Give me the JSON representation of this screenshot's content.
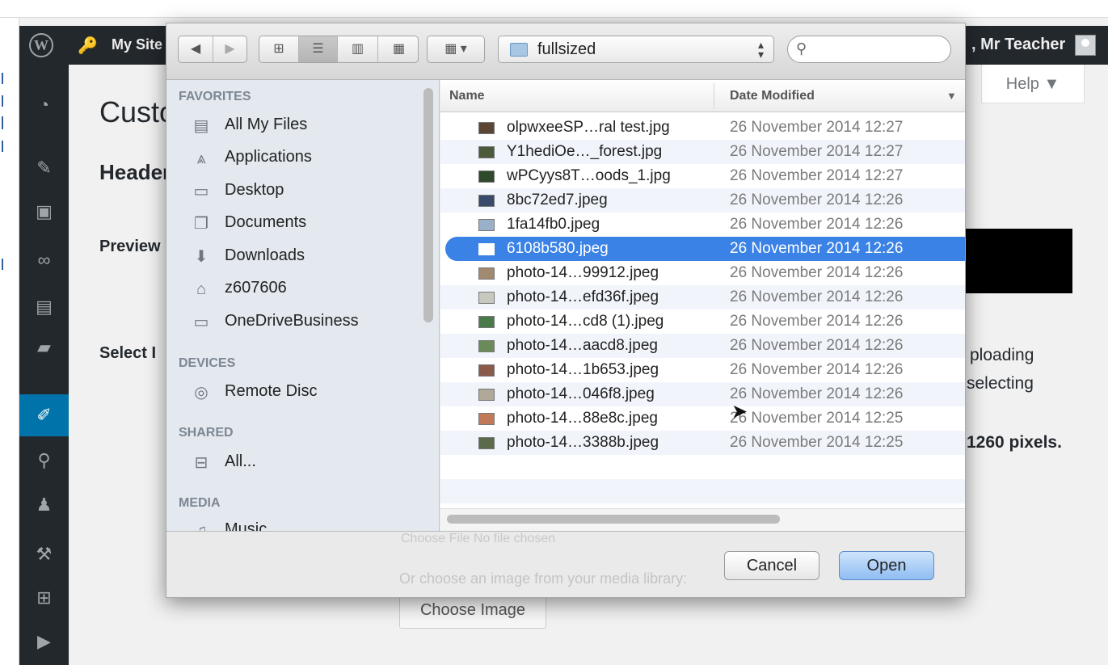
{
  "wp": {
    "logo": "W",
    "site_name": "My Site",
    "howdy": ", Mr Teacher",
    "help": "Help ▼",
    "page_title": "Customize",
    "header_section": "Header",
    "preview_label": "Preview",
    "select_label": "Select I",
    "hint_line1": "ploading",
    "hint_line2": "selecting",
    "hint_line3": "1260 pixels.",
    "choose_image": "Choose Image",
    "ghost_file": "Choose File   No file chosen",
    "ghost_media": "Or choose an image from your media library:",
    "sidebar_icons": [
      "dashboard-icon",
      "pin-icon",
      "media-icon",
      "link-icon",
      "pages-icon",
      "comments-icon",
      "appearance-icon",
      "plugins-icon",
      "users-icon",
      "tools-icon",
      "settings-icon",
      "play-icon"
    ]
  },
  "dialog": {
    "path": "fullsized",
    "search_placeholder": "",
    "sidebar": {
      "favorites_heading": "FAVORITES",
      "favorites": [
        {
          "label": "All My Files",
          "icon": "all-files-icon"
        },
        {
          "label": "Applications",
          "icon": "applications-icon"
        },
        {
          "label": "Desktop",
          "icon": "desktop-icon"
        },
        {
          "label": "Documents",
          "icon": "documents-icon"
        },
        {
          "label": "Downloads",
          "icon": "downloads-icon"
        },
        {
          "label": "z607606",
          "icon": "home-icon"
        },
        {
          "label": "OneDriveBusiness",
          "icon": "folder-icon"
        }
      ],
      "devices_heading": "DEVICES",
      "devices": [
        {
          "label": "Remote Disc",
          "icon": "disc-icon"
        }
      ],
      "shared_heading": "SHARED",
      "shared": [
        {
          "label": "All...",
          "icon": "network-icon"
        }
      ],
      "media_heading": "MEDIA",
      "media": [
        {
          "label": "Music",
          "icon": "music-icon"
        }
      ]
    },
    "columns": {
      "name": "Name",
      "date": "Date Modified"
    },
    "files": [
      {
        "name": "olpwxeeSP…ral test.jpg",
        "date": "26 November 2014 12:27"
      },
      {
        "name": "Y1hediOe…_forest.jpg",
        "date": "26 November 2014 12:27"
      },
      {
        "name": "wPCyys8T…oods_1.jpg",
        "date": "26 November 2014 12:27"
      },
      {
        "name": "8bc72ed7.jpeg",
        "date": "26 November 2014 12:26"
      },
      {
        "name": "1fa14fb0.jpeg",
        "date": "26 November 2014 12:26"
      },
      {
        "name": "6108b580.jpeg",
        "date": "26 November 2014 12:26",
        "selected": true
      },
      {
        "name": "photo-14…99912.jpeg",
        "date": "26 November 2014 12:26"
      },
      {
        "name": "photo-14…efd36f.jpeg",
        "date": "26 November 2014 12:26"
      },
      {
        "name": "photo-14…cd8 (1).jpeg",
        "date": "26 November 2014 12:26"
      },
      {
        "name": "photo-14…aacd8.jpeg",
        "date": "26 November 2014 12:26"
      },
      {
        "name": "photo-14…1b653.jpeg",
        "date": "26 November 2014 12:26"
      },
      {
        "name": "photo-14…046f8.jpeg",
        "date": "26 November 2014 12:26"
      },
      {
        "name": "photo-14…88e8c.jpeg",
        "date": "26 November 2014 12:25"
      },
      {
        "name": "photo-14…3388b.jpeg",
        "date": "26 November 2014 12:25"
      }
    ],
    "cancel": "Cancel",
    "open": "Open"
  },
  "colors": {
    "selection": "#3b82e6",
    "wp_bar": "#23282d",
    "wp_active": "#0073aa"
  }
}
